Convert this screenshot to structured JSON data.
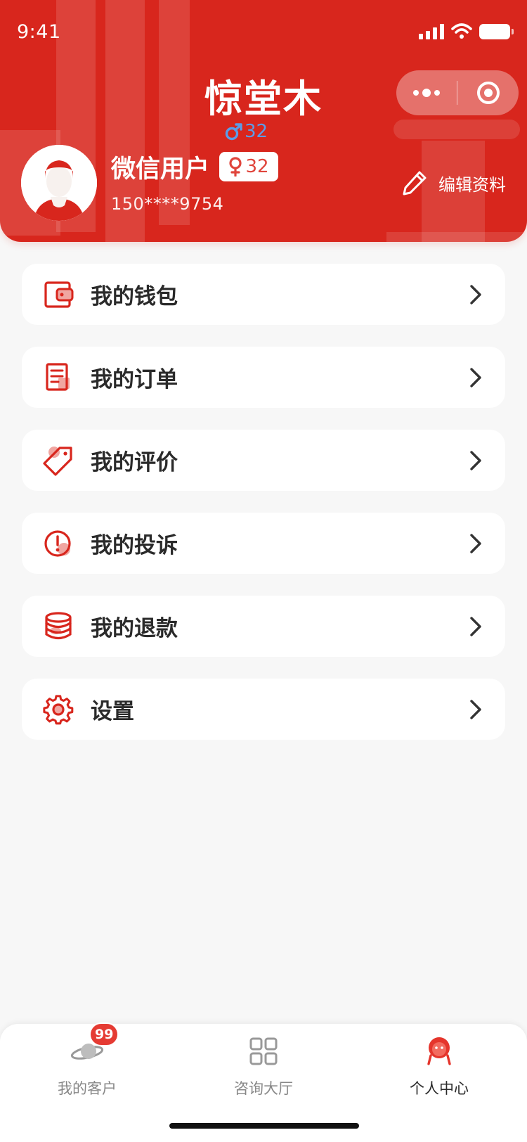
{
  "status_bar": {
    "time": "9:41"
  },
  "header": {
    "app_title": "惊堂木",
    "male_count": "32",
    "user_name": "微信用户",
    "female_count": "32",
    "phone": "150****9754",
    "edit_label": "编辑资料"
  },
  "menu": {
    "items": [
      {
        "label": "我的钱包",
        "icon": "wallet-icon"
      },
      {
        "label": "我的订单",
        "icon": "order-icon"
      },
      {
        "label": "我的评价",
        "icon": "tag-icon"
      },
      {
        "label": "我的投诉",
        "icon": "alert-icon"
      },
      {
        "label": "我的退款",
        "icon": "coins-icon"
      },
      {
        "label": "设置",
        "icon": "gear-icon"
      }
    ]
  },
  "tabbar": {
    "tabs": [
      {
        "label": "我的客户",
        "icon": "planet-icon",
        "badge": "99",
        "active": false
      },
      {
        "label": "咨询大厅",
        "icon": "grid-icon",
        "active": false
      },
      {
        "label": "个人中心",
        "icon": "user-icon",
        "active": true
      }
    ]
  },
  "colors": {
    "brand_red": "#d8261d",
    "male_blue": "#5b9ce8",
    "badge_red": "#e53b33",
    "background": "#f7f7f7"
  }
}
